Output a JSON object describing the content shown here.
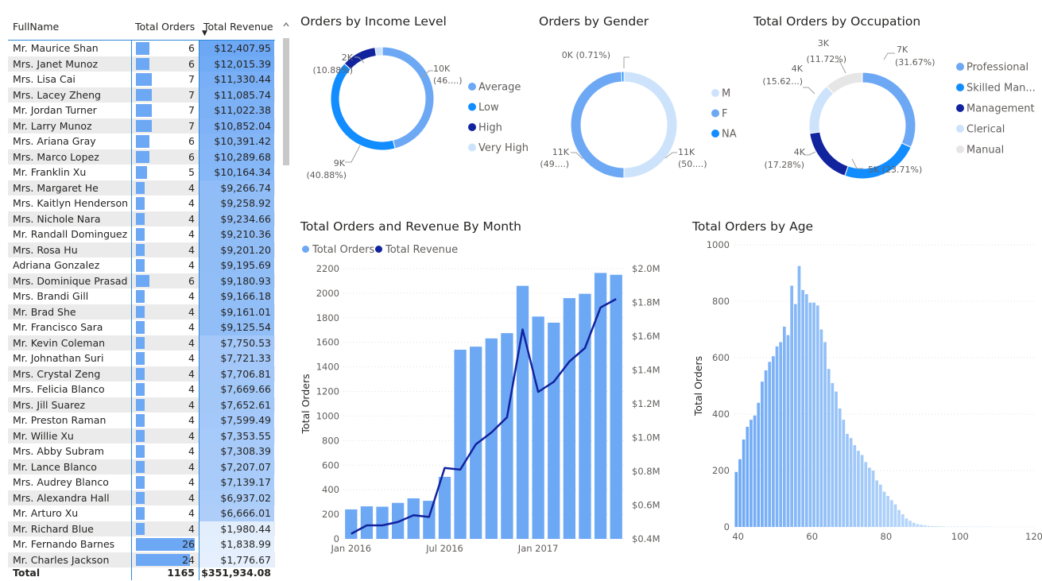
{
  "table": {
    "headers": {
      "name": "FullName",
      "orders": "Total Orders",
      "revenue": "Total Revenue"
    },
    "sort_indicator": "▼",
    "rows": [
      {
        "name": "Mr. Maurice Shan",
        "orders": "6",
        "revenue": "$12,407.95"
      },
      {
        "name": "Mrs. Janet Munoz",
        "orders": "6",
        "revenue": "$12,015.39"
      },
      {
        "name": "Mrs. Lisa Cai",
        "orders": "7",
        "revenue": "$11,330.44"
      },
      {
        "name": "Mrs. Lacey Zheng",
        "orders": "7",
        "revenue": "$11,085.74"
      },
      {
        "name": "Mr. Jordan Turner",
        "orders": "7",
        "revenue": "$11,022.38"
      },
      {
        "name": "Mr. Larry Munoz",
        "orders": "7",
        "revenue": "$10,852.04"
      },
      {
        "name": "Mrs. Ariana Gray",
        "orders": "6",
        "revenue": "$10,391.42"
      },
      {
        "name": "Mrs. Marco Lopez",
        "orders": "6",
        "revenue": "$10,289.68"
      },
      {
        "name": "Mr. Franklin Xu",
        "orders": "5",
        "revenue": "$10,164.34"
      },
      {
        "name": "Mrs. Margaret He",
        "orders": "4",
        "revenue": "$9,266.74"
      },
      {
        "name": "Mrs. Kaitlyn Henderson",
        "orders": "4",
        "revenue": "$9,258.92"
      },
      {
        "name": "Mrs. Nichole Nara",
        "orders": "4",
        "revenue": "$9,234.66"
      },
      {
        "name": "Mr. Randall Dominguez",
        "orders": "4",
        "revenue": "$9,210.36"
      },
      {
        "name": "Mrs. Rosa Hu",
        "orders": "4",
        "revenue": "$9,201.20"
      },
      {
        "name": "Adriana Gonzalez",
        "orders": "4",
        "revenue": "$9,195.69"
      },
      {
        "name": "Mrs. Dominique Prasad",
        "orders": "6",
        "revenue": "$9,180.93"
      },
      {
        "name": "Mrs. Brandi Gill",
        "orders": "4",
        "revenue": "$9,166.18"
      },
      {
        "name": "Mr. Brad She",
        "orders": "4",
        "revenue": "$9,161.01"
      },
      {
        "name": "Mr. Francisco Sara",
        "orders": "4",
        "revenue": "$9,125.54"
      },
      {
        "name": "Mr. Kevin Coleman",
        "orders": "4",
        "revenue": "$7,750.53"
      },
      {
        "name": "Mr. Johnathan Suri",
        "orders": "4",
        "revenue": "$7,721.33"
      },
      {
        "name": "Mrs. Crystal Zeng",
        "orders": "4",
        "revenue": "$7,706.81"
      },
      {
        "name": "Mrs. Felicia Blanco",
        "orders": "4",
        "revenue": "$7,669.66"
      },
      {
        "name": "Mrs. Jill Suarez",
        "orders": "4",
        "revenue": "$7,652.61"
      },
      {
        "name": "Mr. Preston Raman",
        "orders": "4",
        "revenue": "$7,599.49"
      },
      {
        "name": "Mr. Willie Xu",
        "orders": "4",
        "revenue": "$7,353.55"
      },
      {
        "name": "Mrs. Abby Subram",
        "orders": "4",
        "revenue": "$7,308.39"
      },
      {
        "name": "Mr. Lance Blanco",
        "orders": "4",
        "revenue": "$7,207.07"
      },
      {
        "name": "Mrs. Audrey Blanco",
        "orders": "4",
        "revenue": "$7,139.17"
      },
      {
        "name": "Mrs. Alexandra Hall",
        "orders": "4",
        "revenue": "$6,937.02"
      },
      {
        "name": "Mr. Arturo Xu",
        "orders": "4",
        "revenue": "$6,666.01"
      },
      {
        "name": "Mr. Richard Blue",
        "orders": "4",
        "revenue": "$1,980.44"
      },
      {
        "name": "Mr. Fernando Barnes",
        "orders": "26",
        "revenue": "$1,838.99"
      },
      {
        "name": "Mr. Charles Jackson",
        "orders": "24",
        "revenue": "$1,776.67"
      }
    ],
    "total": {
      "label": "Total",
      "orders": "1165",
      "revenue": "$351,934.08"
    },
    "scroll_up_icon": "chevron-up-icon"
  },
  "colors": {
    "bar_blue": "#6da8f5",
    "dark_navy": "#12239e",
    "mid_blue": "#118dff",
    "light_blue": "#cde3fb",
    "grey": "#e6e6e6"
  },
  "chart_data": [
    {
      "type": "pie",
      "title": "Orders by Income Level",
      "style": "donut",
      "labels": [
        "Average",
        "Low",
        "High",
        "Very High"
      ],
      "values": [
        46,
        40.88,
        10.88,
        2.24
      ],
      "colors": [
        "#6da8f5",
        "#118dff",
        "#12239e",
        "#cde3fb"
      ],
      "data_labels": [
        [
          "10K",
          "(46....)"
        ],
        [
          "9K",
          "(40.88%)"
        ],
        [
          "2K",
          "(10.88%)"
        ]
      ],
      "legend": "right"
    },
    {
      "type": "pie",
      "title": "Orders by Gender",
      "style": "donut",
      "labels": [
        "M",
        "F",
        "NA"
      ],
      "values": [
        50,
        49.29,
        0.71
      ],
      "colors": [
        "#cde3fb",
        "#6da8f5",
        "#118dff"
      ],
      "data_labels": [
        [
          "11K",
          "(50....)"
        ],
        [
          "11K",
          "(49....)"
        ],
        [
          "0K (0.71%)"
        ]
      ],
      "legend": "right"
    },
    {
      "type": "pie",
      "title": "Total Orders by Occupation",
      "style": "donut",
      "labels": [
        "Professional",
        "Skilled Man...",
        "Management",
        "Clerical",
        "Manual"
      ],
      "values": [
        31.67,
        23.71,
        17.28,
        15.62,
        11.72
      ],
      "colors": [
        "#6da8f5",
        "#118dff",
        "#12239e",
        "#cde3fb",
        "#e6e6e6"
      ],
      "data_labels": [
        [
          "7K",
          "(31.67%)"
        ],
        [
          "5K (23.71%)"
        ],
        [
          "4K",
          "(17.28%)"
        ],
        [
          "4K",
          "(15.62...)"
        ],
        [
          "3K",
          "(11.72%)"
        ]
      ],
      "legend": "right"
    },
    {
      "type": "bar",
      "title": "Total Orders and Revenue By Month",
      "combo": "bar+line",
      "series": [
        {
          "name": "Total Orders",
          "type": "bar",
          "values": [
            240,
            265,
            262,
            293,
            330,
            310,
            505,
            1540,
            1565,
            1632,
            1675,
            2060,
            1810,
            1760,
            1960,
            1995,
            2165,
            2150
          ]
        },
        {
          "name": "Total Revenue",
          "type": "line",
          "values": [
            0.43,
            0.48,
            0.48,
            0.5,
            0.54,
            0.53,
            0.82,
            0.81,
            0.96,
            1.03,
            1.12,
            1.64,
            1.27,
            1.33,
            1.45,
            1.53,
            1.77,
            1.82
          ]
        }
      ],
      "x_tick_labels": [
        "Jan 2016",
        "Jul 2016",
        "Jan 2017"
      ],
      "ylabel": "Total Orders",
      "ylim": [
        0,
        2200
      ],
      "y_ticks": [
        "0",
        "200",
        "400",
        "600",
        "800",
        "1000",
        "1200",
        "1400",
        "1600",
        "1800",
        "2000",
        "2200"
      ],
      "y2_range_millions": [
        0.4,
        2.0
      ],
      "y2_ticks": [
        "$0.4M",
        "$0.6M",
        "$0.8M",
        "$1.0M",
        "$1.2M",
        "$1.4M",
        "$1.6M",
        "$1.8M",
        "$2.0M"
      ],
      "legend": "top-left",
      "grid": true
    },
    {
      "type": "bar",
      "title": "Total Orders by Age",
      "x_start": 39,
      "values": [
        195,
        240,
        310,
        355,
        380,
        395,
        440,
        515,
        555,
        585,
        605,
        640,
        655,
        710,
        680,
        855,
        790,
        925,
        840,
        825,
        795,
        795,
        785,
        700,
        655,
        560,
        510,
        480,
        420,
        380,
        330,
        315,
        290,
        270,
        255,
        230,
        210,
        200,
        165,
        150,
        125,
        110,
        95,
        80,
        60,
        45,
        30,
        22,
        15,
        10,
        8,
        6,
        4,
        3,
        3,
        2,
        2,
        1,
        1,
        1,
        1,
        1,
        1,
        1,
        1,
        1,
        1,
        1,
        1,
        1
      ],
      "x_ticks": [
        "40",
        "60",
        "80",
        "100",
        "120"
      ],
      "xlim": [
        39,
        120
      ],
      "ylabel": "Total Orders",
      "ylim": [
        0,
        1000
      ],
      "y_ticks": [
        "0",
        "200",
        "400",
        "600",
        "800",
        "1000"
      ],
      "grid": true
    }
  ]
}
